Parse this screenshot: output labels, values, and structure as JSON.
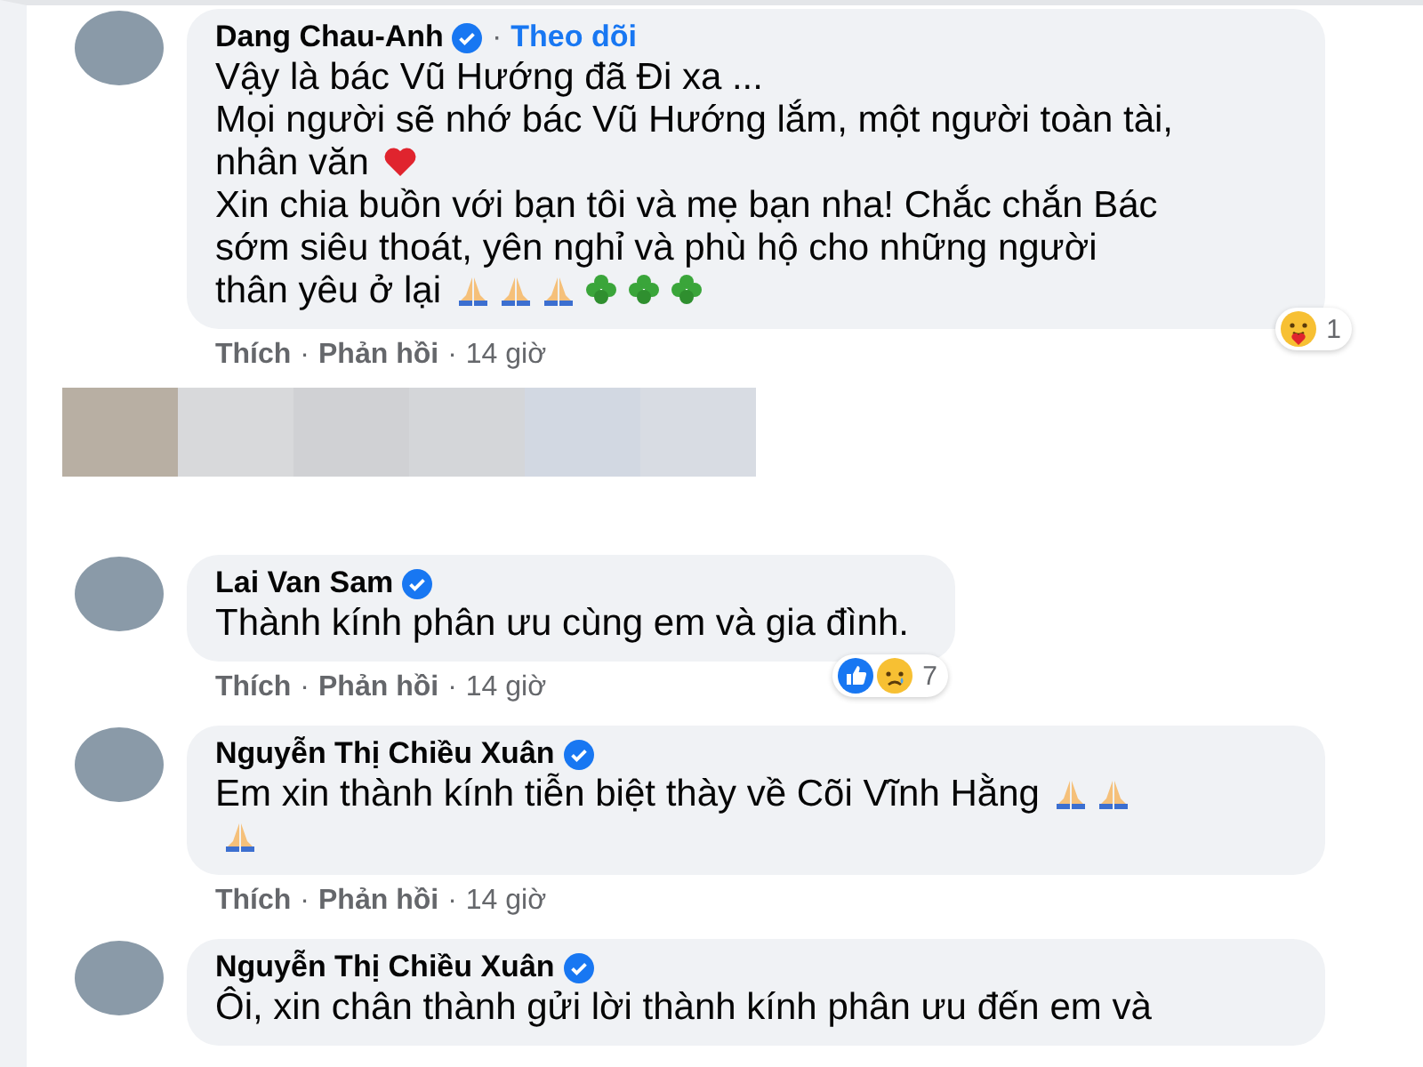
{
  "comments": [
    {
      "author": "Dang Chau-Anh",
      "verified": true,
      "follow": {
        "separator": "·",
        "label": "Theo dõi"
      },
      "lines": [
        {
          "text": "Vậy là bác Vũ Hướng đã Đi xa ..."
        },
        {
          "text": "Mọi người sẽ nhớ bác Vũ Hướng lắm, một người toàn tài,"
        },
        {
          "text": "nhân văn",
          "icons": [
            {
              "kind": "heart"
            }
          ]
        },
        {
          "text": "Xin chia buồn với bạn tôi và mẹ bạn nha! Chắc chắn Bác"
        },
        {
          "text": "sớm siêu thoát, yên nghỉ và phù hộ cho những người"
        },
        {
          "text": "thân yêu ở lại",
          "icons": [
            {
              "kind": "pray"
            },
            {
              "kind": "pray"
            },
            {
              "kind": "pray"
            },
            {
              "kind": "clover"
            },
            {
              "kind": "clover"
            },
            {
              "kind": "clover"
            }
          ]
        }
      ],
      "reactions": {
        "icons": [
          {
            "kind": "care"
          }
        ],
        "count": "1"
      },
      "meta": {
        "like": "Thích",
        "sep1": "·",
        "reply": "Phản hồi",
        "sep2": "·",
        "time": "14 giờ"
      }
    },
    {
      "kind": "blurred"
    },
    {
      "author": "Lai Van Sam",
      "verified": true,
      "lines": [
        {
          "text": "Thành kính phân ưu cùng em và gia đình."
        }
      ],
      "reactions": {
        "icons": [
          {
            "kind": "like"
          },
          {
            "kind": "sad"
          }
        ],
        "count": "7"
      },
      "meta": {
        "like": "Thích",
        "sep1": "·",
        "reply": "Phản hồi",
        "sep2": "·",
        "time": "14 giờ"
      }
    },
    {
      "author": "Nguyễn Thị Chiều Xuân",
      "verified": true,
      "lines": [
        {
          "text": "Em xin thành kính tiễn biệt thày về Cõi Vĩnh Hằng",
          "icons": [
            {
              "kind": "pray"
            },
            {
              "kind": "pray"
            }
          ]
        },
        {
          "icons": [
            {
              "kind": "pray"
            }
          ]
        }
      ],
      "meta": {
        "like": "Thích",
        "sep1": "·",
        "reply": "Phản hồi",
        "sep2": "·",
        "time": "14 giờ"
      }
    },
    {
      "author": "Nguyễn Thị Chiều Xuân",
      "verified": true,
      "lines": [
        {
          "text": "Ôi, xin chân thành gửi lời thành kính phân ưu đến em và"
        }
      ]
    }
  ]
}
